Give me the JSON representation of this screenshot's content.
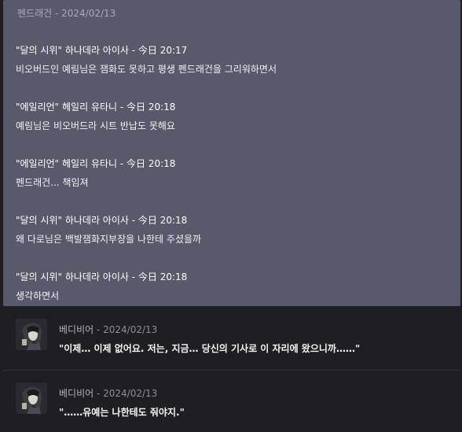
{
  "quote": {
    "header": "펜드래건 - 2024/02/13",
    "lines": [
      "\"달의 시위\" 하나데라 아이사 - 今日 20:17",
      "비오버드인 예림님은 잼화도 못하고 평생 펜드래건을 그리워하면서",
      "\"에일리언\" 헤일리 유타니 - 今日 20:18",
      "예림님은 비오버드라 시트 반납도 못해요",
      "\"에일리언\" 헤일리 유타니 - 今日 20:18",
      "펜드래건... 책임져",
      "\"달의 시위\" 하나데라 아이사 - 今日 20:18",
      "왜 다로님은 백발잼화지부장을 나한테 주셨을까",
      "\"달의 시위\" 하나데라 아이사 - 今日 20:18",
      "생각하면서"
    ]
  },
  "messages": [
    {
      "author": "베디비어",
      "date": " - 2024/02/13",
      "text": "\"이제… 이제 없어요. 저는, 지금… 당신의 기사로 이 자리에 왔으니까……\""
    },
    {
      "author": "베디비어",
      "date": " - 2024/02/13",
      "text": "\"……유예는 나한테도 줘야지.\""
    }
  ]
}
